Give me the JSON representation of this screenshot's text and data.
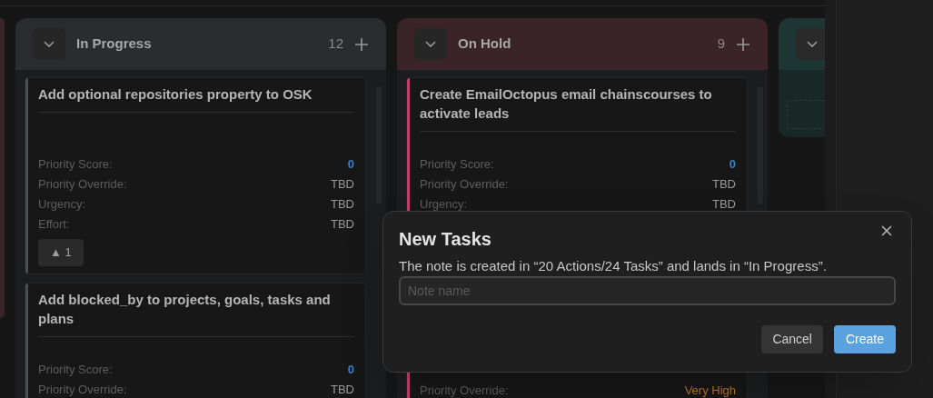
{
  "columns": [
    {
      "kind": "stub",
      "color": "#3a2529"
    },
    {
      "kind": "full",
      "title": "In Progress",
      "count": "12",
      "color": "#2a2c2f",
      "cards": [
        {
          "title": "Add optional repositories property to OSK",
          "color": "#4a4d52",
          "fields": [
            {
              "label": "Priority Score:",
              "value": "0",
              "kind": "score"
            },
            {
              "label": "Priority Override:",
              "value": "TBD",
              "kind": "text"
            },
            {
              "label": "Urgency:",
              "value": "TBD",
              "kind": "text"
            },
            {
              "label": "Effort:",
              "value": "TBD",
              "kind": "text"
            }
          ],
          "votes": "▲ 1"
        },
        {
          "title": "Add blocked_by to projects, goals, tasks and plans",
          "color": "#4a4d52",
          "fields": [
            {
              "label": "Priority Score:",
              "value": "0",
              "kind": "score"
            },
            {
              "label": "Priority Override:",
              "value": "TBD",
              "kind": "text"
            }
          ]
        }
      ]
    },
    {
      "kind": "full",
      "title": "On Hold",
      "count": "9",
      "color": "#3a2429",
      "cards": [
        {
          "title": "Create EmailOctopus email chainscourses to activate leads",
          "color": "#c0406a",
          "fields": [
            {
              "label": "Priority Score:",
              "value": "0",
              "kind": "score"
            },
            {
              "label": "Priority Override:",
              "value": "TBD",
              "kind": "text"
            },
            {
              "label": "Urgency:",
              "value": "TBD",
              "kind": "text"
            }
          ]
        },
        {
          "color": "#c0406a",
          "fields": [
            {
              "label": "Priority Override:",
              "value": "Very High",
              "kind": "priority"
            }
          ]
        }
      ]
    },
    {
      "kind": "empty",
      "color": "#1d3533"
    }
  ],
  "dialog": {
    "title": "New Tasks",
    "message": "The note is created in “20 Actions/24 Tasks” and lands in “In Progress”.",
    "placeholder": "Note name",
    "buttons": [
      {
        "label": "Cancel",
        "kind": "secondary"
      },
      {
        "label": "Create",
        "kind": "primary"
      }
    ]
  }
}
